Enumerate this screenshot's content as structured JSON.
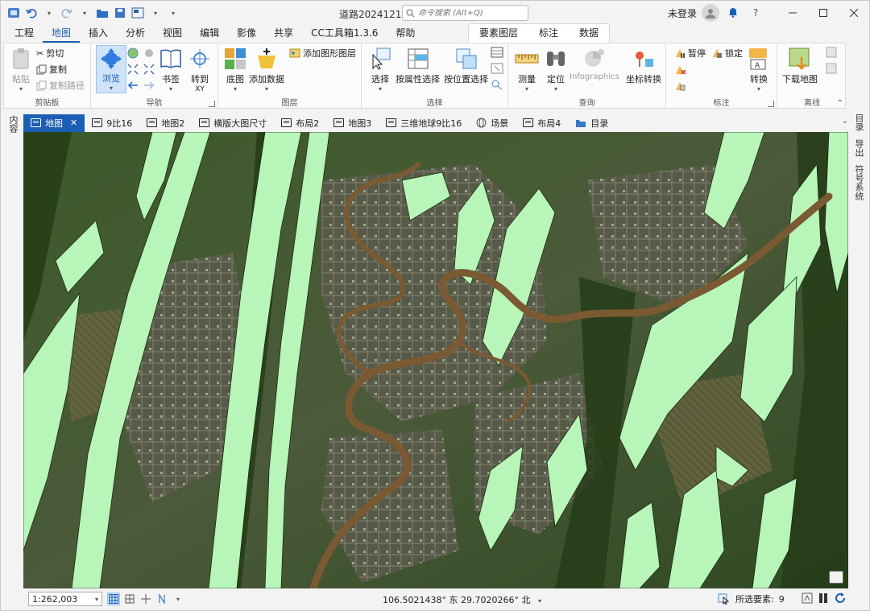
{
  "titlebar": {
    "title": "道路20241219",
    "search_placeholder": "命令搜索 (Alt+Q)",
    "user_label": "未登录"
  },
  "ribbon_tabs": [
    "工程",
    "地图",
    "插入",
    "分析",
    "视图",
    "编辑",
    "影像",
    "共享",
    "CC工具箱1.3.6",
    "帮助"
  ],
  "context_tabs": [
    "要素图层",
    "标注",
    "数据"
  ],
  "ribbon": {
    "clipboard": {
      "paste": "粘贴",
      "cut": "剪切",
      "copy": "复制",
      "copy_path": "复制路径",
      "label": "剪贴板"
    },
    "navigate": {
      "explore": "浏览",
      "bookmarks": "书签",
      "goto": "转到",
      "goto_sub": "XY",
      "label": "导航"
    },
    "layer": {
      "basemap": "底图",
      "add_data": "添加数据",
      "add_graphics": "添加图形图层",
      "label": "图层"
    },
    "selection": {
      "select": "选择",
      "by_attr": "按属性选择",
      "by_loc": "按位置选择",
      "label": "选择"
    },
    "inquiry": {
      "measure": "测量",
      "locate": "定位",
      "infographics": "Infographics",
      "convert_coords": "坐标转换",
      "label": "查询"
    },
    "labeling": {
      "pause": "暂停",
      "lock": "锁定",
      "convert": "转换",
      "label": "标注"
    },
    "offline": {
      "download": "下载地图",
      "label": "离线"
    }
  },
  "side_left": "内容",
  "side_right": [
    "目录",
    "导出",
    "符号系统"
  ],
  "view_tabs": [
    {
      "label": "地图",
      "active": true
    },
    {
      "label": "9比16",
      "active": false
    },
    {
      "label": "地图2",
      "active": false
    },
    {
      "label": "横版大图尺寸",
      "active": false
    },
    {
      "label": "布局2",
      "active": false
    },
    {
      "label": "地图3",
      "active": false
    },
    {
      "label": "三维地球9比16",
      "active": false
    },
    {
      "label": "场景",
      "active": false
    },
    {
      "label": "布局4",
      "active": false
    },
    {
      "label": "目录",
      "active": false
    }
  ],
  "status": {
    "scale": "1:262,003",
    "coordinates": "106.5021438° 东 29.7020266° 北",
    "selected_label": "所选要素:",
    "selected_count": "9"
  },
  "colors": {
    "accent": "#1a5fb4",
    "forest_polygon_fill": "#b8f5b8",
    "river": "#7a5a32",
    "imagery_dark": "#3b5228"
  }
}
